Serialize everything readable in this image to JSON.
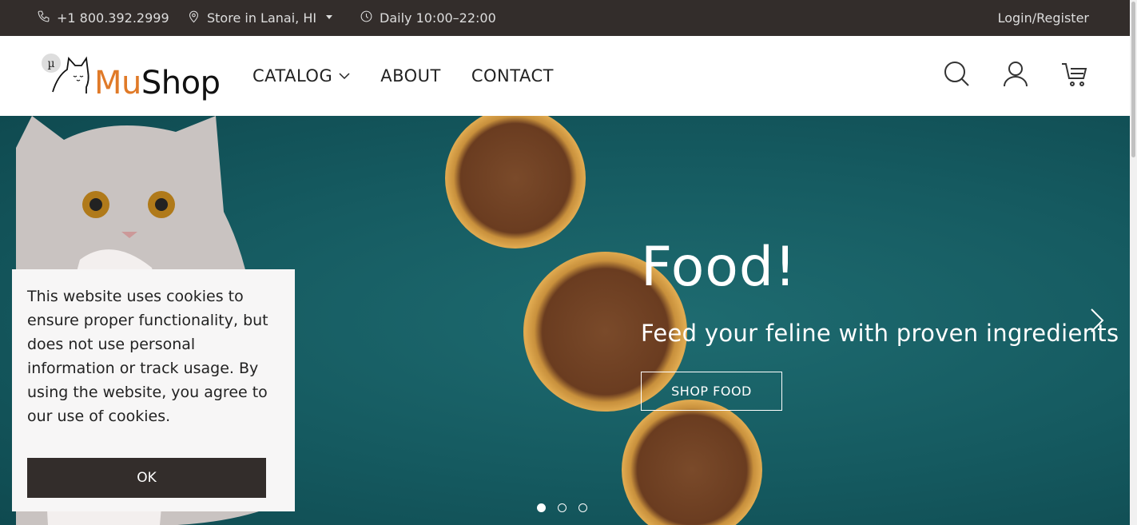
{
  "topbar": {
    "phone": "+1 800.392.2999",
    "store": "Store in Lanai, HI",
    "hours": "Daily 10:00–22:00",
    "login": "Login/Register"
  },
  "header": {
    "logo_mu": "Mu",
    "logo_shop": "Shop",
    "logo_badge": "µ",
    "nav": {
      "catalog": "CATALOG",
      "about": "ABOUT",
      "contact": "CONTACT"
    }
  },
  "hero": {
    "title": "Food!",
    "subtitle": "Feed your feline with proven ingredients",
    "button": "SHOP FOOD",
    "slides": 3,
    "active_slide": 1
  },
  "cookie": {
    "text": "This website uses cookies to ensure proper functionality, but does not use personal information or track usage. By using the website, you agree to our use of cookies.",
    "button": "OK"
  },
  "colors": {
    "accent": "#e07a28",
    "dark": "#332d2b",
    "hero_bg": "#155a60"
  }
}
